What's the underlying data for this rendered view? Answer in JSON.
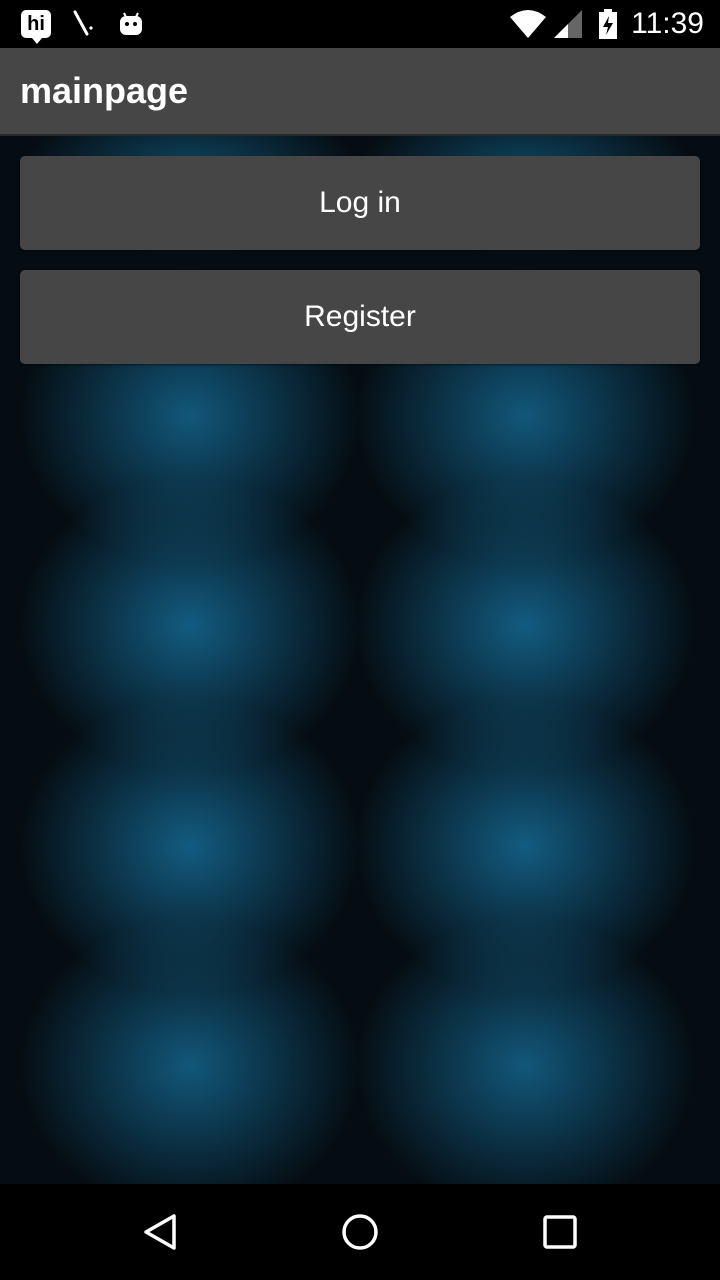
{
  "status_bar": {
    "time": "11:39",
    "notification_icons": [
      "hi-app-icon",
      "pen-icon",
      "android-debug-icon"
    ],
    "system_icons": [
      "wifi-icon",
      "signal-icon",
      "battery-charging-icon"
    ],
    "hi_label": "hi"
  },
  "app_bar": {
    "title": "mainpage"
  },
  "main": {
    "login_label": "Log in",
    "register_label": "Register"
  },
  "nav_bar": {
    "buttons": [
      "back-icon",
      "home-icon",
      "recents-icon"
    ]
  },
  "colors": {
    "app_bar": "#464646",
    "button": "#464646",
    "background_glow": "#14648c",
    "background_dark": "#050d13"
  }
}
